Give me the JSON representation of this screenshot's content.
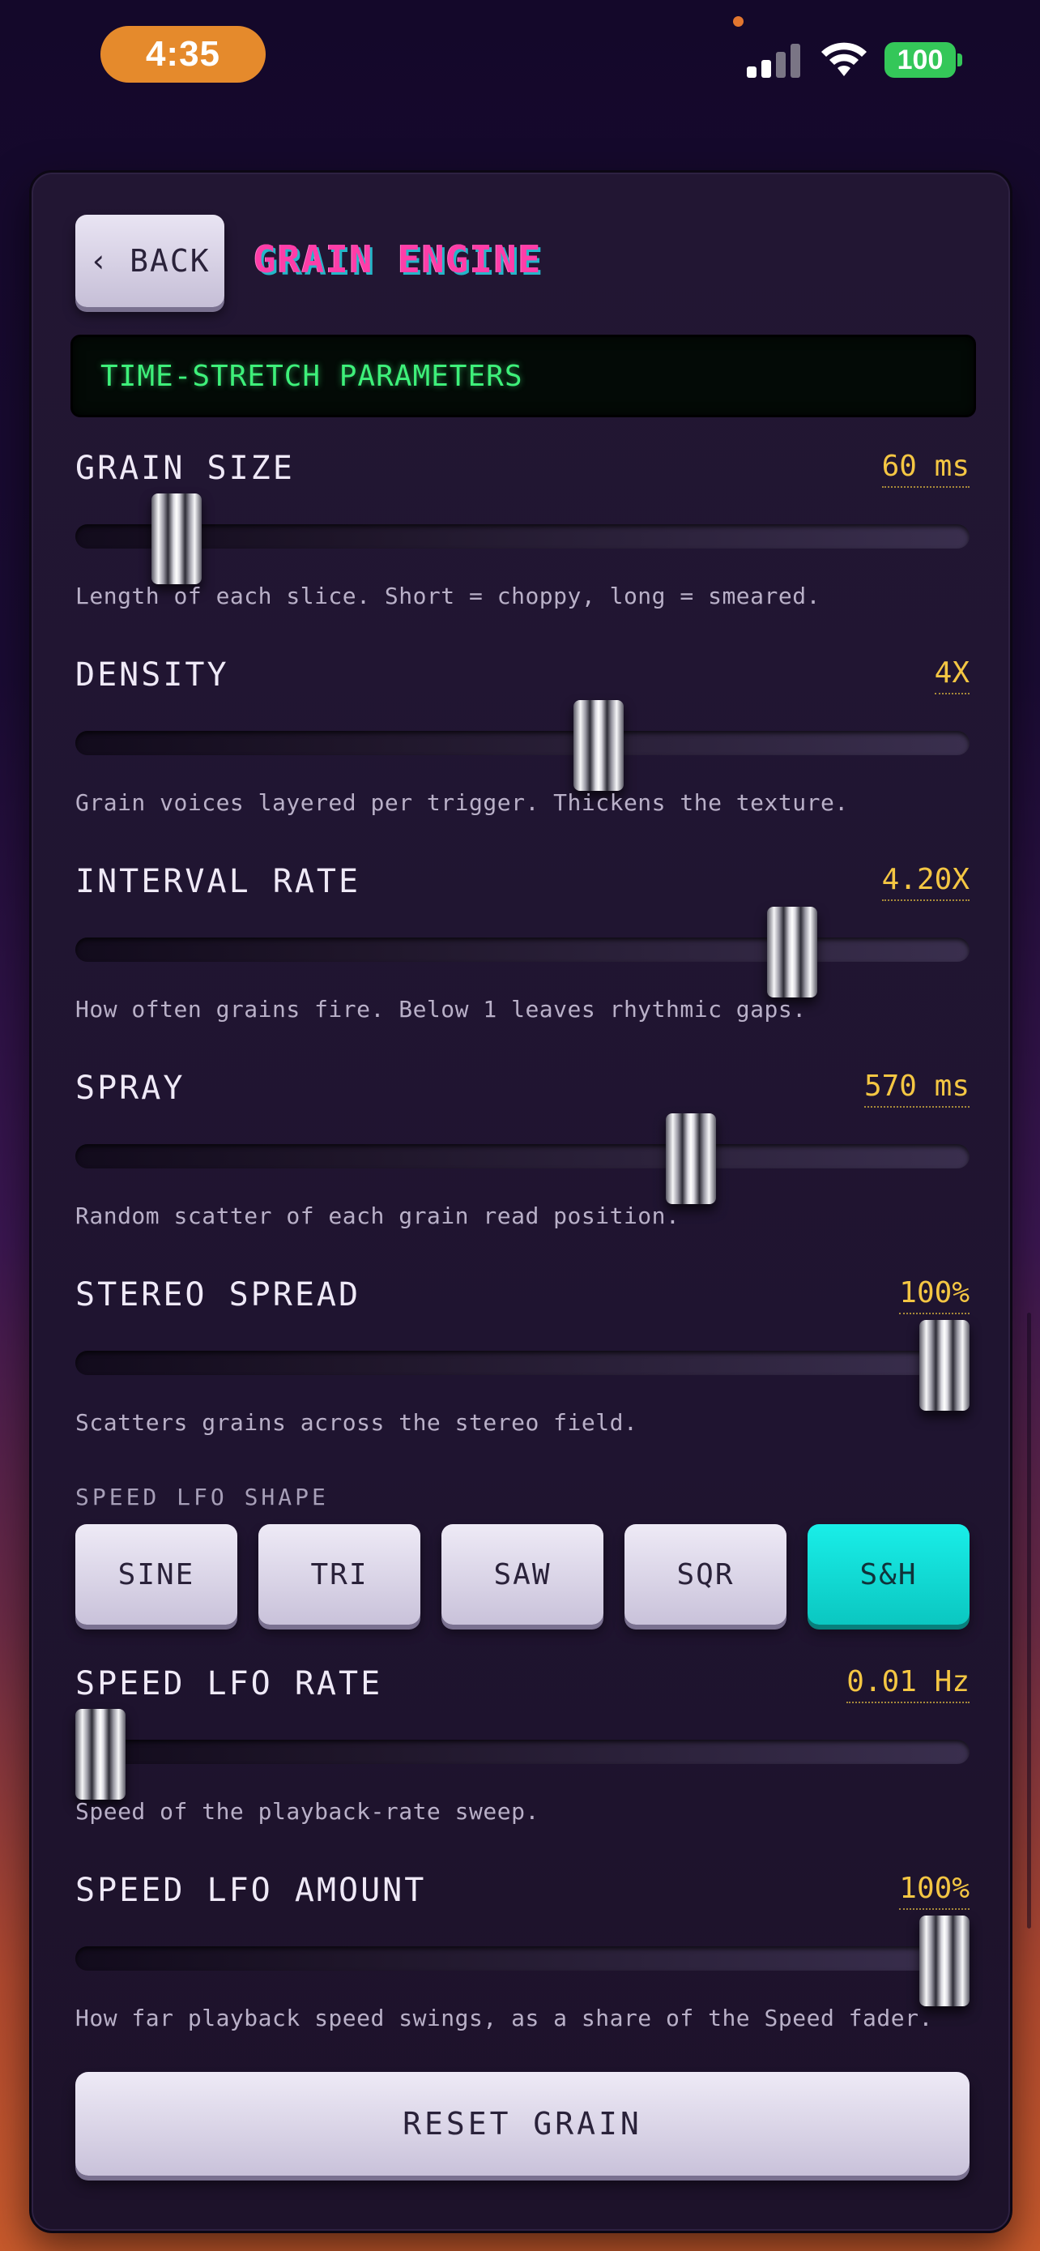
{
  "status_bar": {
    "time": "4:35",
    "battery": "100",
    "icons": [
      "signal-icon",
      "wifi-icon",
      "battery-icon"
    ],
    "time_pill_color": "#e58a2c",
    "battery_color": "#34c759"
  },
  "header": {
    "back_label": "‹ BACK",
    "title": "GRAIN ENGINE"
  },
  "section_title": "TIME-STRETCH PARAMETERS",
  "params": [
    {
      "label": "GRAIN SIZE",
      "value": "60 ms",
      "level": 0.09,
      "desc": "Length of each slice. Short = choppy, long = smeared."
    },
    {
      "label": "DENSITY",
      "value": "4X",
      "level": 0.59,
      "desc": "Grain voices layered per trigger. Thickens the texture."
    },
    {
      "label": "INTERVAL RATE",
      "value": "4.20X",
      "level": 0.82,
      "desc": "How often grains fire. Below 1 leaves rhythmic gaps."
    },
    {
      "label": "SPRAY",
      "value": "570 ms",
      "level": 0.7,
      "desc": "Random scatter of each grain read position."
    },
    {
      "label": "STEREO SPREAD",
      "value": "100%",
      "level": 1.0,
      "desc": "Scatters grains across the stereo field."
    },
    {
      "label": "SPEED LFO RATE",
      "value": "0.01 Hz",
      "level": 0.0,
      "desc": "Speed of the playback-rate sweep."
    },
    {
      "label": "SPEED LFO AMOUNT",
      "value": "100%",
      "level": 1.0,
      "desc": "How far playback speed swings, as a share of the Speed fader."
    }
  ],
  "lfo_shape": {
    "label": "SPEED LFO SHAPE",
    "options": [
      "SINE",
      "TRI",
      "SAW",
      "SQR",
      "S&H"
    ],
    "selected": "S&H",
    "active_color": "#12ddd6"
  },
  "reset_label": "RESET GRAIN",
  "colors": {
    "value_accent": "#f4c643",
    "title_pink": "#ff3da8",
    "title_cyan": "#24b7c9",
    "lcd_green": "#3ef07a"
  }
}
